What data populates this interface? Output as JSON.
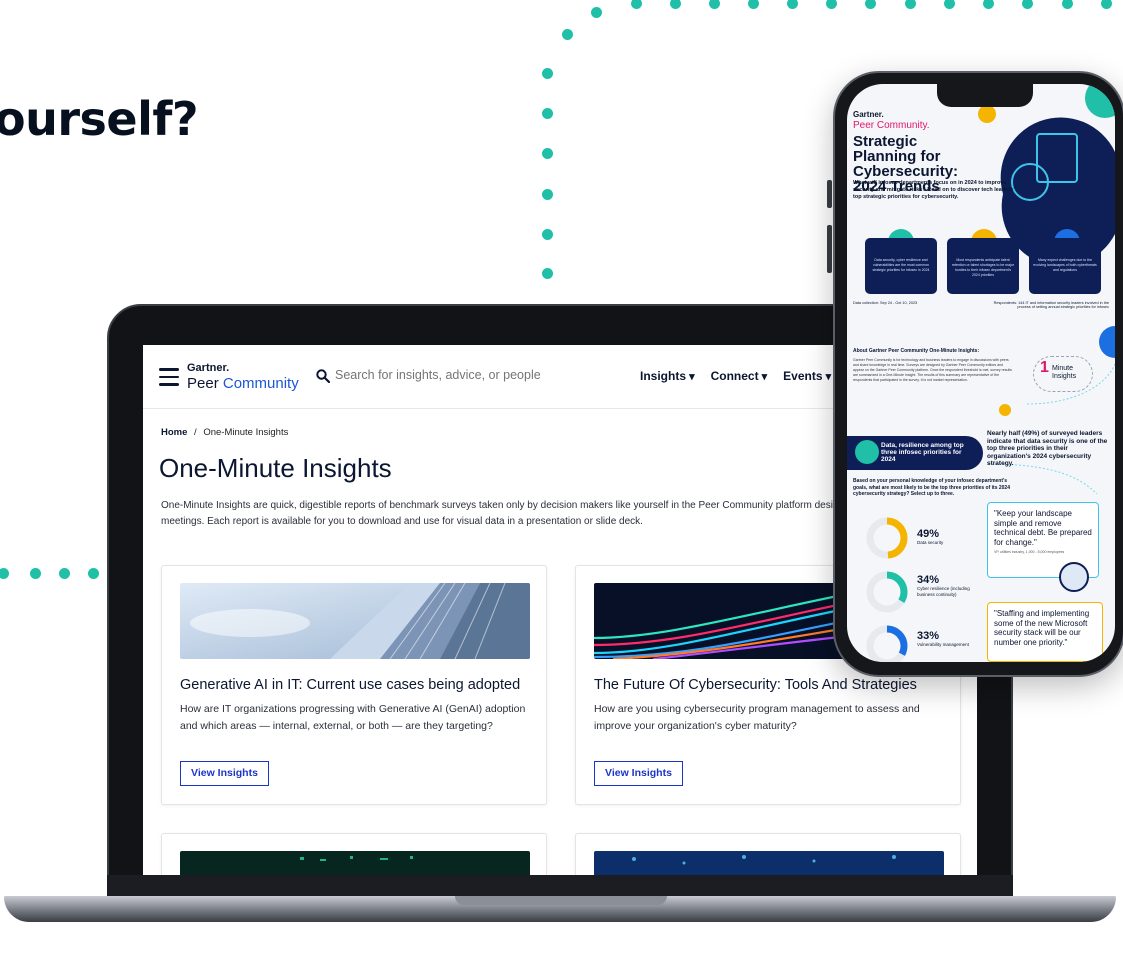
{
  "headline": "ourself?",
  "site": {
    "logo": {
      "brand": "Gartner.",
      "product_a": "Peer ",
      "product_b": "Community"
    },
    "search_placeholder": "Search for insights, advice, or people",
    "nav": [
      "Insights",
      "Connect",
      "Events"
    ],
    "breadcrumb": {
      "home": "Home",
      "separator": "/",
      "current": "One-Minute Insights"
    },
    "page_title": "One-Minute Insights",
    "intro": "One-Minute Insights are quick, digestible reports of benchmark surveys taken only by decision makers like yourself in the Peer Community platform designed to be read between meetings. Each report is available for you to download and use for visual data in a presentation or slide deck.",
    "cards": [
      {
        "title": "Generative AI in IT: Current use cases being adopted",
        "description": "How are IT organizations progressing with Generative AI (GenAI) adoption and which areas — internal, external, or both — are they targeting?",
        "button": "View Insights"
      },
      {
        "title": "The Future Of Cybersecurity: Tools And Strategies",
        "description": "How are you using cybersecurity program management to assess and improve your organization's cyber maturity?",
        "button": "View Insights"
      }
    ]
  },
  "phone": {
    "brand": "Gartner.",
    "product": "Peer Community.",
    "title": "Strategic Planning for Cybersecurity: 2024 Trends",
    "subtitle": "What will infosec departments focus on in 2024 to improve security and mitigate risks? Read on to discover tech leaders' top strategic priorities for cybersecurity.",
    "tiles": [
      "Data security, cyber resilience and vulnerabilities are the most common strategic priorities for infosec in 2024",
      "Most respondents anticipate talent retention or talent shortages to be major hurdles to their infosec department's 2024 priorities",
      "Many expect challenges due to the evolving landscapes of both cyberthreats and regulations"
    ],
    "data_collection": "Data collection: Sep 24 - Oct 10, 2023",
    "respondents": "Respondents: 144 IT and information security leaders involved in the process of setting annual strategic priorities for infosec",
    "about_title": "About Gartner Peer Community One-Minute Insights:",
    "about_text": "Gartner Peer Community is for technology and business leaders to engage in discussions with peers and share knowledge in real time. Surveys are designed by Gartner Peer Community editors and appear on the Gartner Peer Community platform. Once the respondent threshold is met, survey results are summarized in a One-Minute Insight. The results of this summary are representative of the respondents that participated in the survey. It is not market representation.",
    "minute_badge": {
      "number": "1",
      "label_a": "Minute",
      "label_b": "Insights"
    },
    "band": "Data, resilience among top three infosec priorities for 2024",
    "nearly_half": "Nearly half (49%) of surveyed leaders indicate that data security is one of the top three priorities in their organization's 2024 cybersecurity strategy.",
    "question": "Based on your personal knowledge of your infosec department's goals, what are most likely to be the top three priorities of its 2024 cybersecurity strategy? Select up to three.",
    "stats": [
      {
        "pct": "49%",
        "label": "Data security",
        "value": 49,
        "color": "#f5b400"
      },
      {
        "pct": "34%",
        "label": "Cyber resilience (including business continuity)",
        "value": 34,
        "color": "#1fbfa8"
      },
      {
        "pct": "33%",
        "label": "Vulnerability management",
        "value": 33,
        "color": "#1c6fe0"
      }
    ],
    "quote1": "\"Keep your landscape simple and remove technical debt. Be prepared for change.\"",
    "quote1_attr": "VP, utilities industry, 1,000 - 5,000 employees",
    "quote2": "\"Staffing and implementing some of the new Microsoft security stack will be our number one priority.\""
  }
}
